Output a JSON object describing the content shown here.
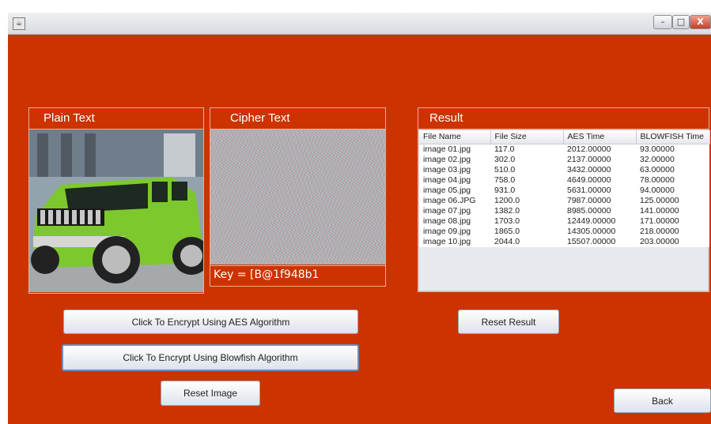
{
  "window": {
    "icon_glyph": "☕",
    "minimize_glyph": "–",
    "maximize_glyph": "□",
    "close_glyph": "X"
  },
  "plain_panel": {
    "title": "Plain Text"
  },
  "cipher_panel": {
    "title": "Cipher Text",
    "key_text": "Key = [B@1f948b1"
  },
  "result_panel": {
    "title": "Result",
    "columns": [
      "File Name",
      "File Size",
      "AES Time",
      "BLOWFISH Time"
    ],
    "rows": [
      [
        "image 01.jpg",
        "117.0",
        "2012.00000",
        "93.00000"
      ],
      [
        "image 02.jpg",
        "302.0",
        "2137.00000",
        "32.00000"
      ],
      [
        "image 03.jpg",
        "510.0",
        "3432.00000",
        "63.00000"
      ],
      [
        "image 04.jpg",
        "758.0",
        "4649.00000",
        "78.00000"
      ],
      [
        "image 05.jpg",
        "931.0",
        "5631.00000",
        "94.00000"
      ],
      [
        "image 06.JPG",
        "1200.0",
        "7987.00000",
        "125.00000"
      ],
      [
        "image 07.jpg",
        "1382.0",
        "8985.00000",
        "141.00000"
      ],
      [
        "image 08.jpg",
        "1703.0",
        "12449.00000",
        "171.00000"
      ],
      [
        "image 09.jpg",
        "1865.0",
        "14305.00000",
        "218.00000"
      ],
      [
        "image 10.jpg",
        "2044.0",
        "15507.00000",
        "203.00000"
      ]
    ]
  },
  "buttons": {
    "encrypt_aes": "Click To Encrypt Using AES Algorithm",
    "encrypt_blowfish": "Click To Encrypt Using Blowfish Algorithm",
    "reset_image": "Reset Image",
    "reset_result": "Reset Result",
    "back": "Back"
  },
  "colors": {
    "background": "#cc3300",
    "panel_border": "#e8b090",
    "button_border": "#9aa3b0"
  }
}
